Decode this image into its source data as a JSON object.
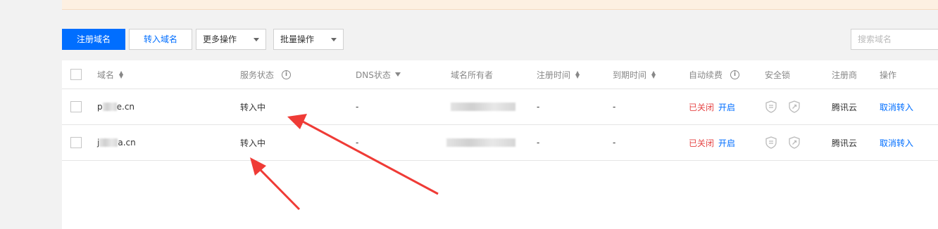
{
  "toolbar": {
    "register_label": "注册域名",
    "transfer_label": "转入域名",
    "more_label": "更多操作",
    "batch_label": "批量操作",
    "search_placeholder": "搜索域名"
  },
  "table": {
    "headers": {
      "domain": "域名",
      "service_status": "服务状态",
      "dns_status": "DNS状态",
      "owner": "域名所有者",
      "register_time": "注册时间",
      "expire_time": "到期时间",
      "auto_renew": "自动续费",
      "security_lock": "安全锁",
      "registrar": "注册商",
      "action": "操作"
    },
    "rows": [
      {
        "domain_prefix": "p",
        "domain_suffix": "e.cn",
        "service_status": "转入中",
        "dns_status": "-",
        "register_time": "-",
        "expire_time": "-",
        "auto_renew_state": "已关闭",
        "auto_renew_action": "开启",
        "registrar": "腾讯云",
        "action": "取消转入"
      },
      {
        "domain_prefix": "j",
        "domain_suffix": "a.cn",
        "service_status": "转入中",
        "dns_status": "-",
        "register_time": "-",
        "expire_time": "-",
        "auto_renew_state": "已关闭",
        "auto_renew_action": "开启",
        "registrar": "腾讯云",
        "action": "取消转入"
      }
    ]
  },
  "colors": {
    "primary": "#006eff",
    "danger": "#e54545",
    "annotation_arrow": "#ef3b36"
  },
  "icons": [
    "sort-icon",
    "info-icon",
    "filter-icon",
    "security-lock-icon",
    "transfer-lock-icon",
    "caret-down-icon"
  ]
}
